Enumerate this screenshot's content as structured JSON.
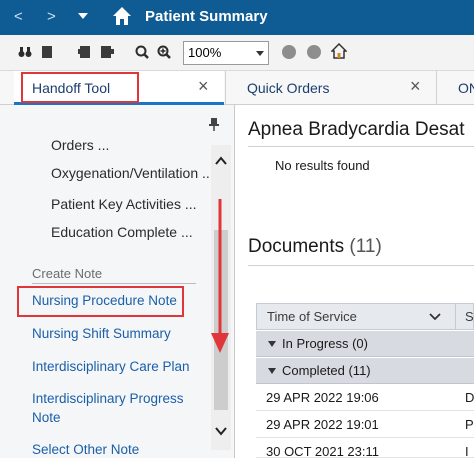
{
  "titlebar": {
    "title": "Patient Summary",
    "back": "<",
    "forward": ">"
  },
  "toolbar": {
    "zoom_value": "100%"
  },
  "tabs": [
    {
      "label": "Handoff Tool",
      "close": "×"
    },
    {
      "label": "Quick Orders",
      "close": "×"
    },
    {
      "label": "ON"
    }
  ],
  "sidebar": {
    "items": [
      "Orders ...",
      "Oxygenation/Ventilation ...",
      "Patient Key Activities ...",
      "Education Complete ..."
    ],
    "section_title": "Create Note",
    "notes": [
      "Nursing Procedure Note",
      "Nursing Shift Summary",
      "Interdisciplinary Care Plan",
      "Interdisciplinary Progress",
      "Note",
      "Select Other Note"
    ]
  },
  "main": {
    "apnea_title": "Apnea Bradycardia Desat",
    "no_results": "No results found",
    "documents_title": "Documents",
    "documents_count": "(11)",
    "table": {
      "col1": "Time of Service",
      "col2": "S",
      "groups": [
        "In Progress (0)",
        "Completed (11)"
      ],
      "rows": [
        {
          "date": "29 APR 2022 19:06",
          "c2": "D"
        },
        {
          "date": "29 APR 2022 19:01",
          "c2": "P"
        },
        {
          "date": "30 OCT 2021 23:11",
          "c2": "I"
        }
      ]
    }
  },
  "colors": {
    "titlebar": "#0f5b94",
    "link": "#1b5fa8",
    "highlight": "#e0353b"
  }
}
